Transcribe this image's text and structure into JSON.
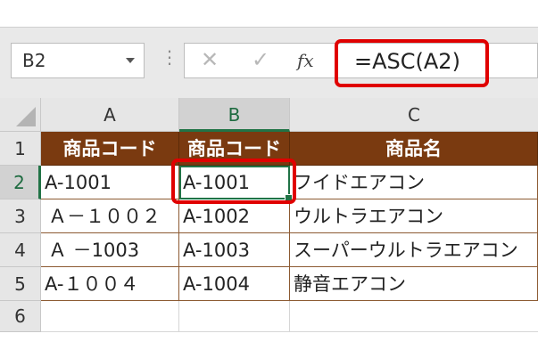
{
  "formula_bar": {
    "name_box": "B2",
    "cancel_glyph": "✕",
    "enter_glyph": "✓",
    "fx_label": "fx",
    "formula": "=ASC(A2)",
    "separator": "⋮"
  },
  "columns": [
    "A",
    "B",
    "C"
  ],
  "selected_column": "B",
  "rows": [
    "1",
    "2",
    "3",
    "4",
    "5",
    "6"
  ],
  "selected_row": "2",
  "header_row": [
    "商品コード",
    "商品コード",
    "商品名"
  ],
  "data_rows": [
    [
      "A-1001",
      "A-1001",
      "フイドエアコン"
    ],
    [
      "Ａ－１００２",
      "A-1002",
      "ウルトラエアコン"
    ],
    [
      "Ａ －1003",
      "A-1003",
      "スーパーウルトラエアコン"
    ],
    [
      "A-１００４",
      "A-1004",
      "静音エアコン"
    ]
  ],
  "colors": {
    "header_fill": "#7a3a10",
    "highlight": "#e00000",
    "selection": "#217346"
  }
}
